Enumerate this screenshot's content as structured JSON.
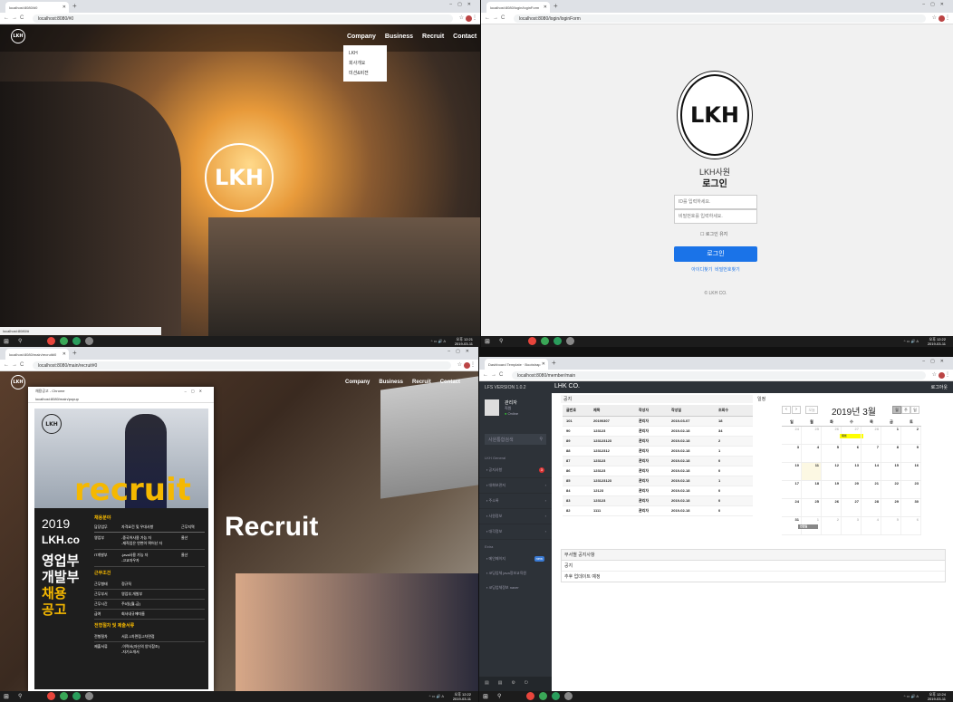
{
  "q1": {
    "tab": "localhost:8080/#0",
    "url": "localhost:8080/#0",
    "nav": [
      "Company",
      "Business",
      "Recruit",
      "Contact"
    ],
    "dropdown": [
      "LKH",
      "회사개요",
      "미션&비젼"
    ],
    "logo": "LKH",
    "status": "localhost:8080/#",
    "time": "오후 12:21",
    "date": "2019-03-11"
  },
  "q2": {
    "tab": "localhost:8080/login/loginForm",
    "url": "localhost:8080/login/loginForm",
    "logo": "LKH",
    "subtitle": "LKH사원",
    "title": "로그인",
    "id_ph": "ID를 입력하세요.",
    "pw_ph": "비밀번호를 입력하세요.",
    "remember": "로그인 유지",
    "login_btn": "로그인",
    "find_id": "아이디찾기",
    "find_pw": "비밀번호찾기",
    "copyright": "© LKH CO.",
    "time": "오후 12:22",
    "date": "2019-03-11"
  },
  "q3": {
    "tab": "localhost:8080/main/recruit#0",
    "url": "localhost:8080/main/recruit#0",
    "nav": [
      "Company",
      "Business",
      "Recruit",
      "Contact"
    ],
    "logo": "LKH",
    "hero": "Recruit",
    "popup_title": "채용공고 - Chrome",
    "popup_url": "localhost:8080/main/popup",
    "popup_logo": "LKH",
    "recruit_word": "recruit",
    "year": "2019",
    "company": "LKH.co",
    "dept1": "영업부",
    "dept2": "개발부",
    "hire1": "채용",
    "hire2": "공고",
    "sec1": "채용분야",
    "head": [
      "담당업무",
      "자격요건 및 우대사항",
      "근무지역"
    ],
    "rows": [
      [
        "영업부",
        "-중국어사용 가능 자\n-재직업은 연변이 뛰어난 자",
        "울산"
      ],
      [
        "IT개발부",
        "-java사용 가능 자\n-고교자우자",
        "울산"
      ]
    ],
    "sec2": "근무조건",
    "cond": [
      [
        "근무형태",
        "정규직"
      ],
      [
        "근무부서",
        "영업부,개발부"
      ],
      [
        "근무시간",
        "주5일(월-금)"
      ],
      [
        "급여",
        "회사내규에따름"
      ]
    ],
    "sec3": "전형절차 및 제출서류",
    "proc": [
      [
        "전형절차",
        "서류-1차면접-2차면접"
      ],
      [
        "제출서류",
        "-이력서(자신의 양식참조)\n-자기소개서"
      ]
    ],
    "time": "오후 12:22",
    "date": "2019-03-11"
  },
  "q4": {
    "tab": "Dashboard Template · Bootstrap",
    "url": "localhost:8080/member/main",
    "brand": "LHK CO.",
    "version": "LFS VERSION 1.0.2",
    "logout": "로그아웃",
    "user": "관리자",
    "user_role": "직원",
    "status": "Online",
    "search_ph": "사원통합검색",
    "general": "LKH General",
    "menu": [
      "공지사항",
      "대화보관저",
      "주소록",
      "사원정보",
      "대각정보"
    ],
    "extra": "Extra",
    "extras": [
      "메인페이지",
      "코딩업체 java정보교육원",
      "코딩업체정보 naver"
    ],
    "badge": "new",
    "notice_title": "공지",
    "cal_title": "일정",
    "cols": [
      "글번호",
      "제목",
      "작성자",
      "작성일",
      "조회수"
    ],
    "notices": [
      [
        "101",
        "20190307",
        "관리자",
        "2019-03-07",
        "18"
      ],
      [
        "90",
        "123123",
        "관리자",
        "2019-02-18",
        "34"
      ],
      [
        "89",
        "123123123",
        "관리자",
        "2019-02-18",
        "2"
      ],
      [
        "88",
        "12312312",
        "관리자",
        "2019-02-18",
        "1"
      ],
      [
        "87",
        "123123",
        "관리자",
        "2019-02-18",
        "0"
      ],
      [
        "86",
        "123123",
        "관리자",
        "2019-02-18",
        "0"
      ],
      [
        "85",
        "123123123",
        "관리자",
        "2019-02-18",
        "1"
      ],
      [
        "84",
        "12123",
        "관리자",
        "2019-02-18",
        "0"
      ],
      [
        "83",
        "123123",
        "관리자",
        "2019-02-18",
        "0"
      ],
      [
        "82",
        "1111",
        "관리자",
        "2019-02-18",
        "0"
      ]
    ],
    "month": "2019년 3월",
    "today_btn": "오늘",
    "views": [
      "월",
      "주",
      "일"
    ],
    "days": [
      "일",
      "월",
      "화",
      "수",
      "목",
      "금",
      "토"
    ],
    "weeks": [
      [
        "24",
        "25",
        "26",
        "27",
        "28",
        "1",
        "2"
      ],
      [
        "3",
        "4",
        "5",
        "6",
        "7",
        "8",
        "9"
      ],
      [
        "10",
        "11",
        "12",
        "13",
        "14",
        "15",
        "16"
      ],
      [
        "17",
        "18",
        "19",
        "20",
        "21",
        "22",
        "23"
      ],
      [
        "24",
        "25",
        "26",
        "27",
        "28",
        "29",
        "30"
      ],
      [
        "31",
        "1",
        "2",
        "3",
        "4",
        "5",
        "6"
      ]
    ],
    "event1": "회의",
    "event2": "면접일",
    "dept_notice": "부서별 공지사항",
    "notice_row": "공지",
    "update_row": "추후 업데이트 예정",
    "time": "오후 12:24",
    "date": "2019-03-11"
  }
}
